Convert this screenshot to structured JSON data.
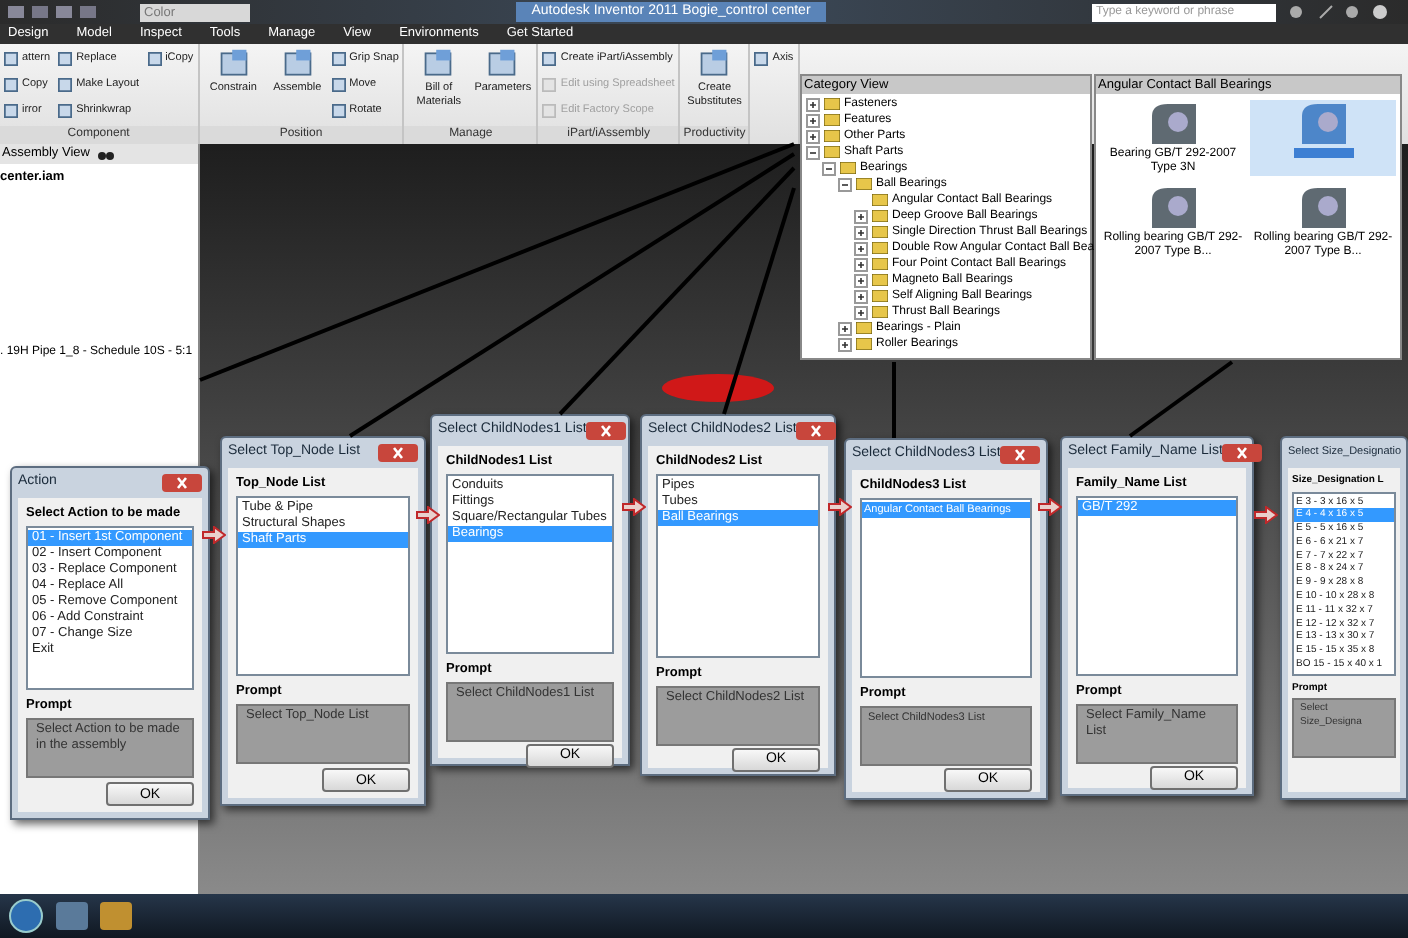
{
  "title_bar": {
    "style_field": "Color",
    "title": "Autodesk Inventor 2011  Bogie_control center",
    "search": {
      "placeholder": "Type a keyword or phrase"
    }
  },
  "menu_tabs": [
    {
      "label": "Design",
      "selected": false
    },
    {
      "label": "Model",
      "selected": false
    },
    {
      "label": "Inspect",
      "selected": false
    },
    {
      "label": "Tools",
      "selected": false
    },
    {
      "label": "Manage",
      "selected": false
    },
    {
      "label": "View",
      "selected": false
    },
    {
      "label": "Environments",
      "selected": false
    },
    {
      "label": "Get Started",
      "selected": false
    }
  ],
  "ribbon": {
    "panels": [
      {
        "title": "Component",
        "tools": [
          {
            "label": "attern",
            "kind": "small"
          },
          {
            "label": "Copy",
            "kind": "small"
          },
          {
            "label": "irror",
            "kind": "small"
          },
          {
            "label": "Replace",
            "kind": "small"
          },
          {
            "label": "Make Layout",
            "kind": "small"
          },
          {
            "label": "Shrinkwrap",
            "kind": "small"
          },
          {
            "label": "iCopy",
            "kind": "small"
          }
        ]
      },
      {
        "title": "Position",
        "tools": [
          {
            "label": "Constrain",
            "kind": "large"
          },
          {
            "label": "Assemble",
            "kind": "large"
          },
          {
            "label": "Grip Snap",
            "kind": "small"
          },
          {
            "label": "Move",
            "kind": "small"
          },
          {
            "label": "Rotate",
            "kind": "small"
          }
        ]
      },
      {
        "title": "Manage",
        "tools": [
          {
            "label": "Bill of Materials",
            "kind": "large"
          },
          {
            "label": "Parameters",
            "kind": "large"
          }
        ]
      },
      {
        "title": "iPart/iAssembly",
        "tools": [
          {
            "label": "Create iPart/iAssembly",
            "kind": "small",
            "disabled": false
          },
          {
            "label": "Edit using Spreadsheet",
            "kind": "small",
            "disabled": true
          },
          {
            "label": "Edit Factory Scope",
            "kind": "small",
            "disabled": true
          }
        ]
      },
      {
        "title": "Productivity",
        "tools": [
          {
            "label": "Create Substitutes",
            "kind": "large"
          }
        ]
      },
      {
        "tools": [
          {
            "label": "Axis",
            "kind": "small"
          }
        ]
      }
    ]
  },
  "browser": {
    "title": "Assembly View",
    "items": [
      "center.iam",
      ". 19H Pipe 1_8 - Schedule 10S - 5:1"
    ]
  },
  "category_view": {
    "title": "Category View",
    "items": [
      {
        "label": "Fasteners",
        "expanded": false
      },
      {
        "label": "Features",
        "expanded": false
      },
      {
        "label": "Other Parts",
        "expanded": false
      },
      {
        "label": "Shaft Parts",
        "expanded": true,
        "children": [
          {
            "label": "Bearings",
            "expanded": true,
            "children": [
              {
                "label": "Ball Bearings",
                "expanded": true,
                "children": [
                  {
                    "label": "Angular Contact Ball Bearings"
                  },
                  {
                    "label": "Deep Groove Ball Bearings",
                    "expanded": false
                  },
                  {
                    "label": "Single Direction Thrust Ball Bearings",
                    "expanded": false
                  },
                  {
                    "label": "Double Row Angular Contact Ball Bea",
                    "expanded": false
                  },
                  {
                    "label": "Four Point Contact Ball Bearings",
                    "expanded": false
                  },
                  {
                    "label": "Magneto Ball Bearings",
                    "expanded": false
                  },
                  {
                    "label": "Self Aligning Ball Bearings",
                    "expanded": false
                  },
                  {
                    "label": "Thrust Ball Bearings",
                    "expanded": false
                  }
                ]
              },
              {
                "label": "Bearings - Plain",
                "expanded": false
              },
              {
                "label": "Roller Bearings",
                "expanded": false
              }
            ]
          }
        ]
      }
    ]
  },
  "family_view": {
    "title": "Angular Contact Ball Bearings",
    "items": [
      {
        "label": "Bearing GB/T 292-2007 Type 3N",
        "selected": false
      },
      {
        "selected": true
      },
      {
        "label": "Rolling bearing GB/T 292-2007 Type B...",
        "selected": false
      },
      {
        "label": "Rolling bearing GB/T 292-2007 Type B...",
        "selected": false
      }
    ]
  },
  "dialogs": [
    {
      "title": "Action",
      "heading": "Select Action to be made",
      "items": [
        {
          "label": "01 - Insert 1st Component",
          "selected": true
        },
        {
          "label": "02 - Insert Component",
          "selected": false
        },
        {
          "label": "03 - Replace Component",
          "selected": false
        },
        {
          "label": "04 - Replace All",
          "selected": false
        },
        {
          "label": "05 - Remove Component",
          "selected": false
        },
        {
          "label": "06 - Add Constraint",
          "selected": false
        },
        {
          "label": "07 - Change Size",
          "selected": false
        },
        {
          "label": "Exit",
          "selected": false
        }
      ],
      "prompt_label": "Prompt",
      "prompt": "Select Action to be made in the assembly",
      "ok": "OK"
    },
    {
      "title": "Select Top_Node List",
      "heading": "Top_Node List",
      "items": [
        {
          "label": "Tube & Pipe",
          "selected": false
        },
        {
          "label": "Structural Shapes",
          "selected": false
        },
        {
          "label": "Shaft Parts",
          "selected": true
        }
      ],
      "prompt_label": "Prompt",
      "prompt": "Select Top_Node List",
      "ok": "OK"
    },
    {
      "title": "Select ChildNodes1 List",
      "heading": "ChildNodes1 List",
      "items": [
        {
          "label": "Conduits",
          "selected": false
        },
        {
          "label": "Fittings",
          "selected": false
        },
        {
          "label": "Square/Rectangular Tubes",
          "selected": false
        },
        {
          "label": "Bearings",
          "selected": true
        }
      ],
      "prompt_label": "Prompt",
      "prompt": "Select ChildNodes1 List",
      "ok": "OK"
    },
    {
      "title": "Select ChildNodes2 List",
      "heading": "ChildNodes2 List",
      "items": [
        {
          "label": "Pipes",
          "selected": false
        },
        {
          "label": "Tubes",
          "selected": false
        },
        {
          "label": "Ball Bearings",
          "selected": true
        }
      ],
      "prompt_label": "Prompt",
      "prompt": "Select ChildNodes2 List",
      "ok": "OK"
    },
    {
      "title": "Select ChildNodes3 List",
      "heading": "ChildNodes3 List",
      "items": [
        {
          "label": "Angular Contact Ball Bearings",
          "selected": true
        }
      ],
      "prompt_label": "Prompt",
      "prompt": "Select ChildNodes3 List",
      "ok": "OK"
    },
    {
      "title": "Select Family_Name List",
      "heading": "Family_Name List",
      "items": [
        {
          "label": "GB/T 292",
          "selected": true
        }
      ],
      "prompt_label": "Prompt",
      "prompt": "Select Family_Name List",
      "ok": "OK"
    },
    {
      "title": "Select Size_Designatio",
      "heading": "Size_Designation L",
      "items": [
        {
          "label": "E 3 - 3 x 16 x 5",
          "selected": false
        },
        {
          "label": "E 4 - 4 x 16 x 5",
          "selected": true
        },
        {
          "label": "E 5 - 5 x 16 x 5",
          "selected": false
        },
        {
          "label": "E 6 - 6 x 21 x 7",
          "selected": false
        },
        {
          "label": "E 7 - 7 x 22 x 7",
          "selected": false
        },
        {
          "label": "E 8 - 8 x 24 x 7",
          "selected": false
        },
        {
          "label": "E 9 - 9 x 28 x 8",
          "selected": false
        },
        {
          "label": "E 10 - 10 x 28 x 8",
          "selected": false
        },
        {
          "label": "E 11 - 11 x 32 x 7",
          "selected": false
        },
        {
          "label": "E 12 - 12 x 32 x 7",
          "selected": false
        },
        {
          "label": "E 13 - 13 x 30 x 7",
          "selected": false
        },
        {
          "label": "E 15 - 15 x 35 x 8",
          "selected": false
        },
        {
          "label": "BO 15 - 15 x 40 x 1",
          "selected": false
        }
      ],
      "prompt_label": "Prompt",
      "prompt": "Select Size_Designa"
    }
  ]
}
